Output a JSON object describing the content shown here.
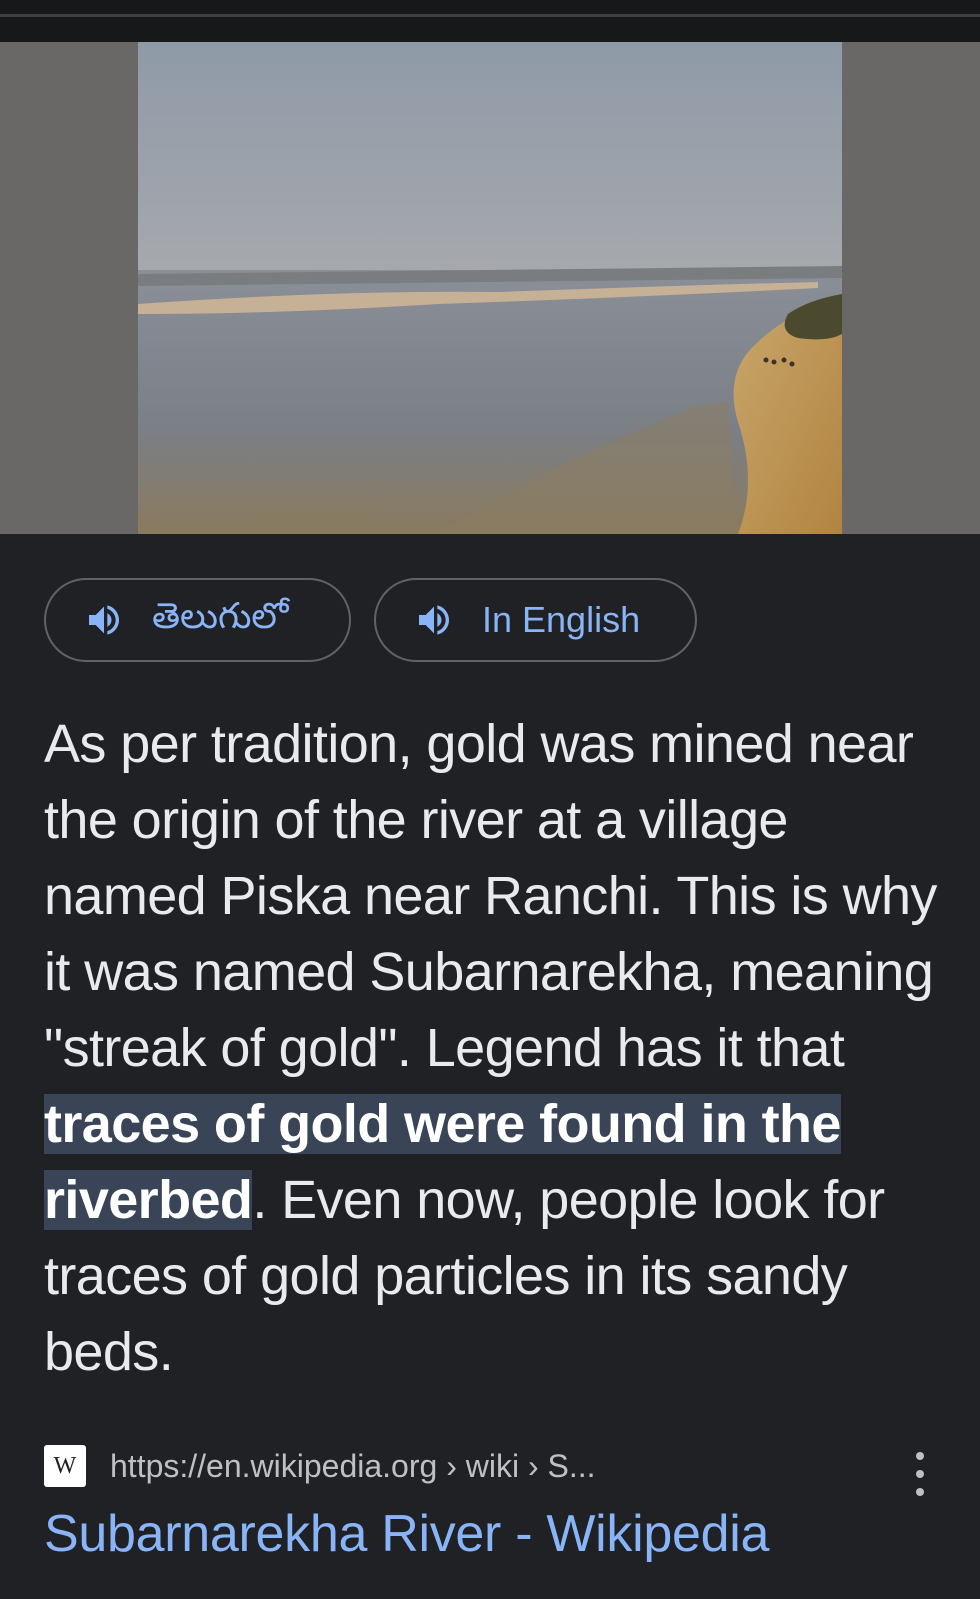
{
  "image": {
    "description_icon": "river-photo"
  },
  "audio_buttons": [
    {
      "label": "తెలుగులో",
      "icon": "speaker-icon"
    },
    {
      "label": "In English",
      "icon": "speaker-icon"
    }
  ],
  "snippet": {
    "text_before": "As per tradition, gold was mined near the origin of the river at a village named Piska near Ranchi. This is why it was named Subarnarekha, meaning \"streak of gold\". Legend has it that ",
    "highlight": "traces of gold were found in the riverbed",
    "text_after": ". Even now, people look for traces of gold particles in its sandy beds."
  },
  "source": {
    "favicon_letter": "W",
    "url": "https://en.wikipedia.org › wiki › S...",
    "title": "Subarnarekha River - Wikipedia"
  },
  "colors": {
    "background": "#202124",
    "link": "#8ab4f8",
    "highlight": "#394457"
  }
}
